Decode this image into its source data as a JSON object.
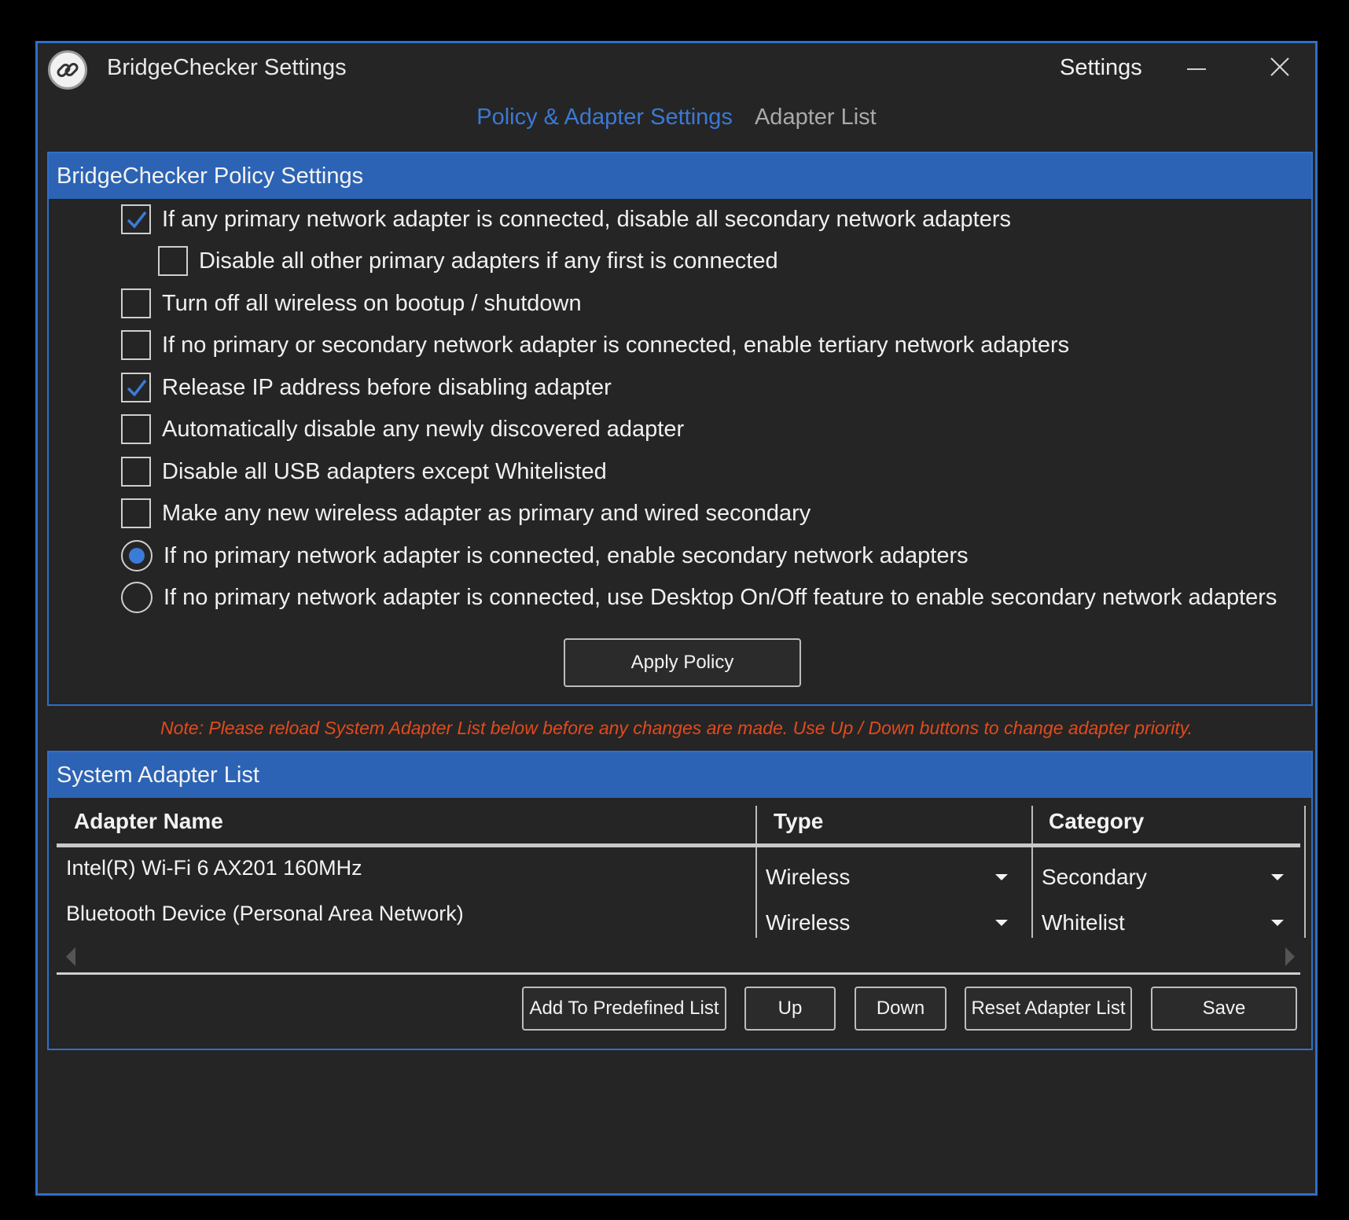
{
  "window": {
    "title": "BridgeChecker Settings",
    "header_right": "Settings"
  },
  "tabs": [
    {
      "label": "Policy & Adapter Settings",
      "active": true
    },
    {
      "label": "Adapter List",
      "active": false
    }
  ],
  "policy": {
    "header": "BridgeChecker Policy Settings",
    "options": [
      {
        "type": "checkbox",
        "checked": true,
        "label": "If any primary network adapter is connected, disable all secondary network adapters"
      },
      {
        "type": "checkbox",
        "checked": false,
        "label": "Disable all other primary adapters if any first is connected"
      },
      {
        "type": "checkbox",
        "checked": false,
        "label": "Turn off all wireless on bootup / shutdown"
      },
      {
        "type": "checkbox",
        "checked": false,
        "label": "If no primary or secondary network adapter is connected, enable tertiary network adapters"
      },
      {
        "type": "checkbox",
        "checked": true,
        "label": "Release IP address before disabling adapter"
      },
      {
        "type": "checkbox",
        "checked": false,
        "label": "Automatically disable any newly discovered adapter"
      },
      {
        "type": "checkbox",
        "checked": false,
        "label": "Disable all USB adapters except Whitelisted"
      },
      {
        "type": "checkbox",
        "checked": false,
        "label": "Make any new wireless adapter as primary and wired secondary"
      },
      {
        "type": "radio",
        "checked": true,
        "label": "If no primary network adapter is connected, enable secondary network adapters"
      },
      {
        "type": "radio",
        "checked": false,
        "label": "If no primary network adapter is connected, use Desktop On/Off feature to enable secondary network adapters"
      }
    ],
    "apply_label": "Apply Policy"
  },
  "note": "Note: Please reload System Adapter List below before any changes are made. Use Up / Down buttons to change adapter priority.",
  "adapters": {
    "header": "System Adapter List",
    "columns": [
      "Adapter Name",
      "Type",
      "Category"
    ],
    "rows": [
      {
        "name": "Intel(R) Wi-Fi 6 AX201 160MHz",
        "type": "Wireless",
        "category": "Secondary"
      },
      {
        "name": "Bluetooth Device (Personal Area Network)",
        "type": "Wireless",
        "category": "Whitelist"
      }
    ],
    "buttons": {
      "add_predefined": "Add To Predefined List",
      "up": "Up",
      "down": "Down",
      "reset": "Reset Adapter List",
      "save": "Save"
    }
  },
  "colors": {
    "accent": "#2c63b4",
    "active_tab": "#3b79d4",
    "note": "#e34a1c"
  },
  "icons": [
    "link-icon",
    "minimize-icon",
    "close-icon",
    "checkmark-icon",
    "dropdown-arrow-icon",
    "scroll-left-icon",
    "scroll-right-icon"
  ]
}
